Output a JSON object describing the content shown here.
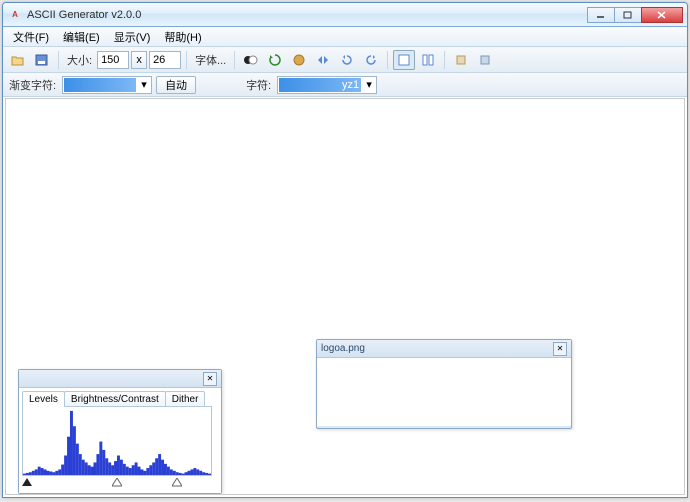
{
  "window": {
    "title": "ASCII Generator v2.0.0"
  },
  "menu": {
    "file": "文件(F)",
    "edit": "编辑(E)",
    "view": "显示(V)",
    "help": "帮助(H)"
  },
  "toolbar": {
    "size_label": "大小:",
    "width": "150",
    "x": "x",
    "height": "26",
    "font_label": "字体..."
  },
  "toolbar2": {
    "gradient_label": "渐变字符:",
    "auto_btn": "自动",
    "chars_label": "字符:",
    "chars_value": "yz1"
  },
  "levels_panel": {
    "tabs": {
      "levels": "Levels",
      "bc": "Brightness/Contrast",
      "dither": "Dither"
    }
  },
  "image_panel": {
    "title": "logoa.png"
  },
  "chart_data": {
    "type": "bar",
    "title": "Levels histogram",
    "xlabel": "",
    "ylabel": "",
    "xlim": [
      0,
      255
    ],
    "ylim": [
      0,
      100
    ],
    "values": [
      2,
      3,
      4,
      6,
      8,
      12,
      10,
      8,
      6,
      5,
      4,
      6,
      8,
      15,
      28,
      55,
      92,
      70,
      45,
      30,
      22,
      18,
      14,
      12,
      18,
      30,
      48,
      36,
      24,
      18,
      14,
      20,
      28,
      22,
      16,
      12,
      10,
      14,
      18,
      12,
      8,
      6,
      10,
      14,
      18,
      24,
      30,
      22,
      16,
      12,
      8,
      6,
      4,
      3,
      2,
      4,
      6,
      8,
      10,
      8,
      6,
      4,
      3,
      2
    ],
    "markers": {
      "black": 0,
      "mid": 128,
      "white": 255
    }
  }
}
